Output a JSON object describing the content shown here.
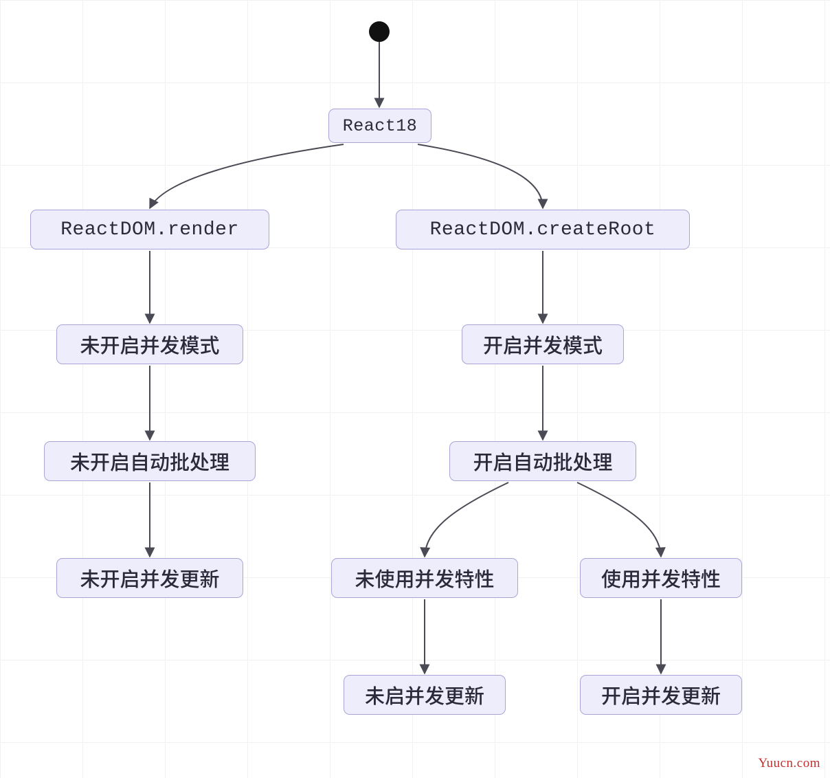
{
  "chart_data": {
    "type": "flowchart",
    "root": "React18",
    "nodes": {
      "react18": "React18",
      "render": "ReactDOM.render",
      "createRoot": "ReactDOM.createRoot",
      "noConcurrentMode": "未开启并发模式",
      "concurrentMode": "开启并发模式",
      "noAutoBatch": "未开启自动批处理",
      "autoBatch": "开启自动批处理",
      "noConcurrentUpdateLeft": "未开启并发更新",
      "noConcurrentFeature": "未使用并发特性",
      "concurrentFeature": "使用并发特性",
      "noConcurrentUpdateRight": "未启并发更新",
      "concurrentUpdate": "开启并发更新"
    },
    "edges": [
      [
        "start",
        "react18"
      ],
      [
        "react18",
        "render"
      ],
      [
        "react18",
        "createRoot"
      ],
      [
        "render",
        "noConcurrentMode"
      ],
      [
        "createRoot",
        "concurrentMode"
      ],
      [
        "noConcurrentMode",
        "noAutoBatch"
      ],
      [
        "concurrentMode",
        "autoBatch"
      ],
      [
        "noAutoBatch",
        "noConcurrentUpdateLeft"
      ],
      [
        "autoBatch",
        "noConcurrentFeature"
      ],
      [
        "autoBatch",
        "concurrentFeature"
      ],
      [
        "noConcurrentFeature",
        "noConcurrentUpdateRight"
      ],
      [
        "concurrentFeature",
        "concurrentUpdate"
      ]
    ]
  },
  "nodes": {
    "react18": "React18",
    "render": "ReactDOM.render",
    "createRoot": "ReactDOM.createRoot",
    "noConcurrentMode": "未开启并发模式",
    "concurrentMode": "开启并发模式",
    "noAutoBatch": "未开启自动批处理",
    "autoBatch": "开启自动批处理",
    "noConcurrentUpdateLeft": "未开启并发更新",
    "noConcurrentFeature": "未使用并发特性",
    "concurrentFeature": "使用并发特性",
    "noConcurrentUpdateRight": "未启并发更新",
    "concurrentUpdate": "开启并发更新"
  },
  "watermark": "Yuucn.com"
}
